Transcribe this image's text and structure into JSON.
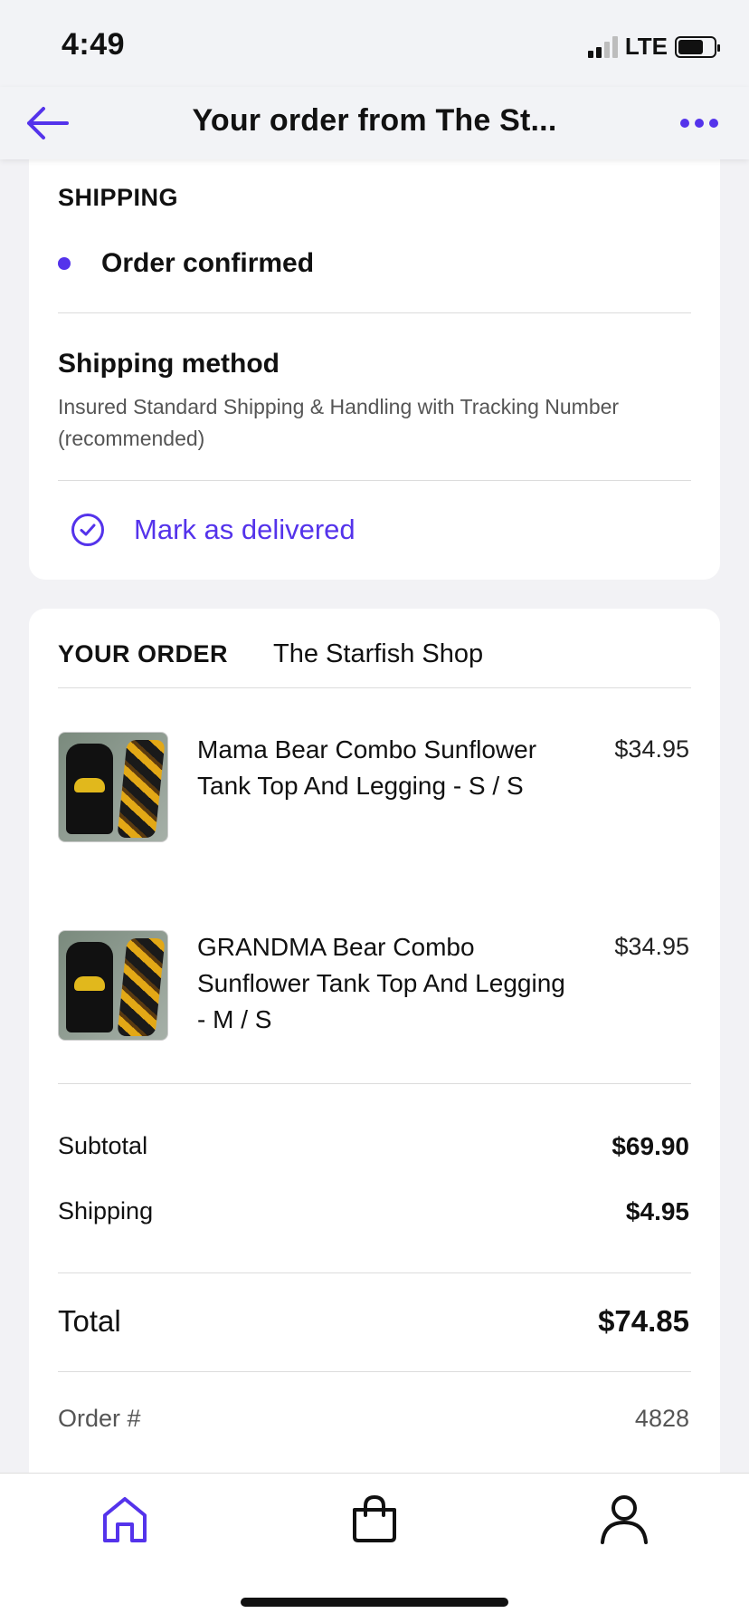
{
  "status_bar": {
    "time": "4:49",
    "network": "LTE",
    "battery_level": 0.7
  },
  "nav": {
    "title": "Your order from The St...",
    "back_icon": "arrow-left-icon",
    "more_icon": "more-horizontal-icon"
  },
  "shipping": {
    "heading": "SHIPPING",
    "status": "Order confirmed",
    "method_title": "Shipping method",
    "method_desc": "Insured Standard Shipping & Handling with Tracking Number (recommended)",
    "mark_delivered": "Mark as delivered"
  },
  "order": {
    "heading": "YOUR ORDER",
    "shop": "The Starfish Shop",
    "items": [
      {
        "name": "Mama Bear Combo Sunflower Tank Top And Legging - S / S",
        "price": "$34.95"
      },
      {
        "name": "GRANDMA Bear Combo Sunflower Tank Top And Legging - M / S",
        "price": "$34.95"
      }
    ],
    "subtotal_label": "Subtotal",
    "subtotal": "$69.90",
    "shipping_label": "Shipping",
    "shipping": "$4.95",
    "total_label": "Total",
    "total": "$74.85",
    "order_num_label": "Order #",
    "order_num": "4828"
  },
  "tabs": [
    "home-icon",
    "shopping-bag-icon",
    "profile-icon"
  ],
  "colors": {
    "accent": "#5433eb",
    "background": "#f2f2f5"
  }
}
